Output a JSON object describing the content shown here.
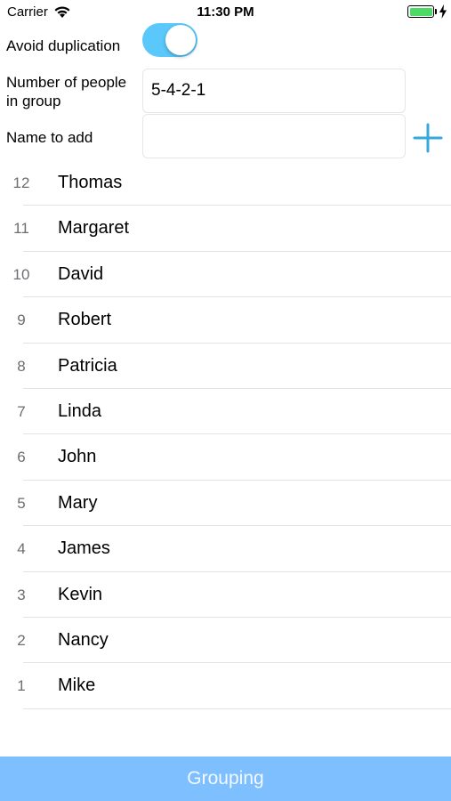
{
  "status_bar": {
    "carrier": "Carrier",
    "time": "11:30 PM",
    "battery_level": 1.0
  },
  "form": {
    "avoid_duplication_label": "Avoid duplication",
    "avoid_duplication_on": true,
    "group_size_label_line1": "Number of people",
    "group_size_label_line2": "in group",
    "group_size_value": "5-4-2-1",
    "name_label": "Name to add",
    "name_value": "",
    "add_icon": "plus-icon"
  },
  "people": [
    {
      "num": "12",
      "name": "Thomas"
    },
    {
      "num": "11",
      "name": "Margaret"
    },
    {
      "num": "10",
      "name": "David"
    },
    {
      "num": "9",
      "name": "Robert"
    },
    {
      "num": "8",
      "name": "Patricia"
    },
    {
      "num": "7",
      "name": "Linda"
    },
    {
      "num": "6",
      "name": "John"
    },
    {
      "num": "5",
      "name": "Mary"
    },
    {
      "num": "4",
      "name": "James"
    },
    {
      "num": "3",
      "name": "Kevin"
    },
    {
      "num": "2",
      "name": "Nancy"
    },
    {
      "num": "1",
      "name": "Mike"
    }
  ],
  "footer": {
    "grouping_label": "Grouping"
  },
  "colors": {
    "accent": "#34aadc",
    "toggle_on": "#5ac8fa",
    "grouping_button": "#7dbfff",
    "battery": "#4cd964"
  }
}
